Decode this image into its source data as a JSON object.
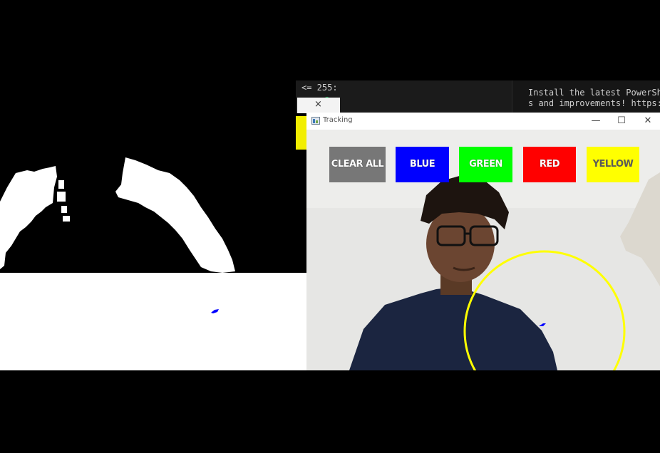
{
  "terminal": {
    "comparison_text": "<= 255:",
    "prompt_glyph": "@",
    "tab_close_glyph": "×",
    "powershell_line1": "Install the latest PowerShel",
    "powershell_line2": "s and improvements! https:/"
  },
  "tracking_window": {
    "title": "Tracking",
    "minimize_glyph": "—",
    "maximize_glyph": "☐",
    "close_glyph": "✕",
    "buttons": [
      {
        "label": "CLEAR ALL",
        "color": "#777777"
      },
      {
        "label": "BLUE",
        "color": "#0000ff"
      },
      {
        "label": "GREEN",
        "color": "#00ff00"
      },
      {
        "label": "RED",
        "color": "#ff0000"
      },
      {
        "label": "YELLOW",
        "color": "#ffff00"
      }
    ],
    "tracker_circle_color": "#ffff00",
    "drawn_stroke_color": "#0000ff"
  },
  "mask_window": {
    "background": "#000000",
    "blob_color": "#ffffff"
  },
  "paint_window": {
    "background": "#ffffff",
    "stroke_color": "#0000ff"
  }
}
